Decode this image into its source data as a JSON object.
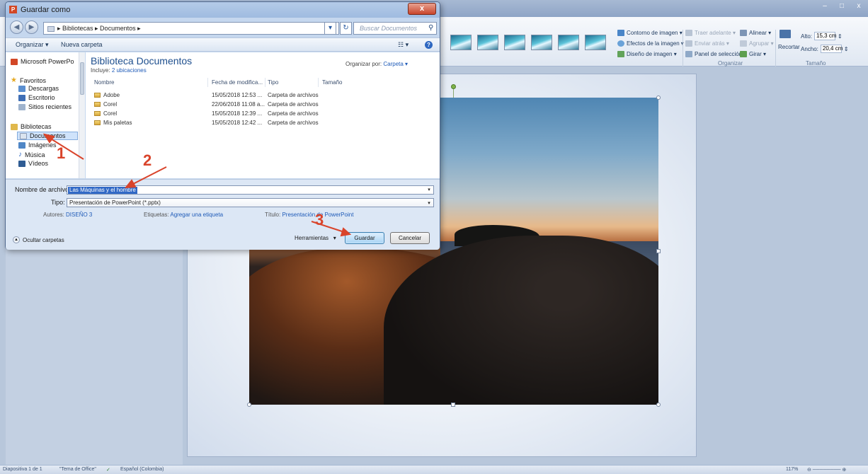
{
  "dialog": {
    "title": "Guardar como",
    "close_glyph": "x",
    "address": {
      "path": "▸ Bibliotecas ▸ Documentos ▸"
    },
    "search_placeholder": "Buscar Documentos",
    "toolbar": {
      "organize": "Organizar ▾",
      "new_folder": "Nueva carpeta",
      "views": "☷ ▾"
    },
    "nav": {
      "app": "Microsoft PowerPo",
      "favorites": "Favoritos",
      "downloads": "Descargas",
      "desktop": "Escritorio",
      "recent": "Sitios recientes",
      "libraries": "Bibliotecas",
      "documents": "Documentos",
      "images": "Imágenes",
      "music": "Música",
      "videos": "Vídeos"
    },
    "library": {
      "title": "Biblioteca Documentos",
      "includes_label": "Incluye:",
      "includes_link": "2 ubicaciones",
      "arrange_label": "Organizar por:",
      "arrange_value": "Carpeta ▾"
    },
    "columns": {
      "name": "Nombre",
      "modified": "Fecha de modifica...",
      "type": "Tipo",
      "size": "Tamaño"
    },
    "files": [
      {
        "name": "Adobe",
        "modified": "15/05/2018 12:53 ...",
        "type": "Carpeta de archivos"
      },
      {
        "name": "Corel",
        "modified": "22/06/2018 11:08 a...",
        "type": "Carpeta de archivos"
      },
      {
        "name": "Corel",
        "modified": "15/05/2018 12:39 ...",
        "type": "Carpeta de archivos"
      },
      {
        "name": "Mis paletas",
        "modified": "15/05/2018 12:42 ...",
        "type": "Carpeta de archivos"
      }
    ],
    "form": {
      "filename_label": "Nombre de archivo:",
      "filename_value": "Las Máquinas y el hombre",
      "type_label": "Tipo:",
      "type_value": "Presentación de PowerPoint (*.pptx)",
      "authors_label": "Autores:",
      "authors_value": "DISEÑO 3",
      "tags_label": "Etiquetas:",
      "tags_value": "Agregar una etiqueta",
      "title_label": "Título:",
      "title_value": "Presentación de PowerPoint"
    },
    "hide_folders": "Ocultar carpetas",
    "tools": "Herramientas",
    "save": "Guardar",
    "cancel": "Cancelar"
  },
  "annotations": [
    "1",
    "2",
    "3"
  ],
  "ribbon": {
    "picture_border": "Contorno de imagen ▾",
    "picture_effects": "Efectos de la imagen ▾",
    "picture_layout": "Diseño de imagen ▾",
    "bring_forward": "Traer adelante ▾",
    "send_backward": "Enviar atrás ▾",
    "selection_pane": "Panel de selección",
    "align": "Alinear ▾",
    "group": "Agrupar ▾",
    "rotate": "Girar ▾",
    "group_arrange": "Organizar",
    "crop": "Recortar",
    "height_label": "Alto:",
    "height_value": "15,3 cm",
    "width_label": "Ancho:",
    "width_value": "20,4 cm",
    "group_size": "Tamaño"
  },
  "statusbar": {
    "slide": "Diapositiva 1 de 1",
    "theme": "\"Tema de Office\"",
    "language": "Español (Colombia)",
    "zoom": "117%"
  },
  "colors": {
    "accent_annotation": "#d9442b",
    "dialog_frame": "#c5d7ee",
    "link": "#1f5bb8"
  }
}
